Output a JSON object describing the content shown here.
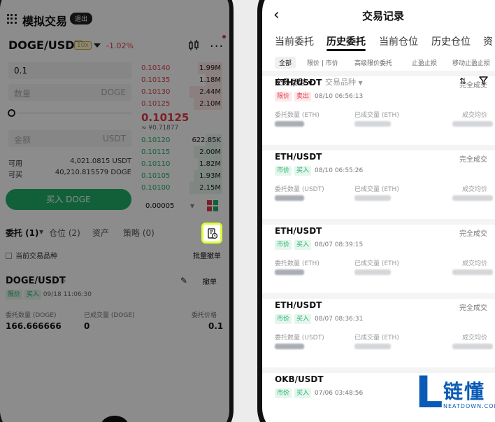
{
  "left": {
    "app_title": "模拟交易",
    "exit_label": "退出",
    "pair": "DOGE/USDT",
    "leverage": "10x",
    "change": "-1.02%",
    "price_value": "0.1",
    "qty_placeholder": "数量",
    "qty_unit": "DOGE",
    "amount_placeholder": "金额",
    "amount_unit": "USDT",
    "available_label": "可用",
    "available_value": "4,021.0815 USDT",
    "can_buy_label": "可买",
    "can_buy_value": "40,210.815579 DOGE",
    "buy_button": "买入 DOGE",
    "asks": [
      {
        "price": "0.10140",
        "qty": "1.99M",
        "depth": 0.3
      },
      {
        "price": "0.10135",
        "qty": "1.18M",
        "depth": 0.2
      },
      {
        "price": "0.10130",
        "qty": "2.44M",
        "depth": 0.4
      },
      {
        "price": "0.10125",
        "qty": "2.10M",
        "depth": 0.35
      }
    ],
    "mid_price": "0.10125",
    "mid_fiat": "≈ ¥0.71877",
    "bids": [
      {
        "price": "0.10120",
        "qty": "622.85K",
        "depth": 0.2
      },
      {
        "price": "0.10115",
        "qty": "2.00M",
        "depth": 0.35
      },
      {
        "price": "0.10110",
        "qty": "1.82M",
        "depth": 0.3
      },
      {
        "price": "0.10105",
        "qty": "1.93M",
        "depth": 0.35
      },
      {
        "price": "0.10100",
        "qty": "2.15M",
        "depth": 0.4
      }
    ],
    "depth_step": "0.00005",
    "tabs": [
      "委托 (1)",
      "仓位 (2)",
      "资产",
      "策略 (0)"
    ],
    "current_only": "当前交易品种",
    "batch_cancel": "批量撤单",
    "order": {
      "pair": "DOGE/USDT",
      "cancel": "撤单",
      "type_tag": "限价",
      "side_tag": "买入",
      "time": "09/18 11:06:30",
      "qty_label": "委托数量 (DOGE)",
      "qty_value": "166.666666",
      "filled_label": "已成交量 (DOGE)",
      "filled_value": "0",
      "price_label": "委托价格",
      "price_value": "0.1"
    }
  },
  "right": {
    "title": "交易记录",
    "tabs": [
      "当前委托",
      "历史委托",
      "当前仓位",
      "历史仓位",
      "资"
    ],
    "sub_tabs": [
      "全部",
      "限价 | 市价",
      "高级限价委托",
      "止盈止损",
      "移动止盈止损"
    ],
    "filters": [
      "交易类型",
      "交易品种"
    ],
    "records": [
      {
        "pair": "ETH/USDT",
        "status": "完全成交",
        "type_tag": "限价",
        "side_tag": "卖出",
        "time": "08/10 06:56:13",
        "col1": "委托数量 (ETH)",
        "col2": "已成交量 (ETH)",
        "col3": "成交均价"
      },
      {
        "pair": "ETH/USDT",
        "status": "完全成交",
        "type_tag": "市价",
        "side_tag": "买入",
        "time": "08/10 06:55:26",
        "col1": "委托数量 (USDT)",
        "col2": "已成交量 (ETH)",
        "col3": "成交均价"
      },
      {
        "pair": "ETH/USDT",
        "status": "完全成交",
        "type_tag": "市价",
        "side_tag": "买入",
        "time": "08/07 08:39:15",
        "col1": "委托数量 (ETH)",
        "col2": "已成交量 (ETH)",
        "col3": "成交均价"
      },
      {
        "pair": "ETH/USDT",
        "status": "完全成交",
        "type_tag": "市价",
        "side_tag": "买入",
        "time": "08/07 08:36:31",
        "col1": "委托数量 (USDT)",
        "col2": "已成交量 (ETH)",
        "col3": "成交均价"
      },
      {
        "pair": "OKB/USDT",
        "status": "",
        "type_tag": "市价",
        "side_tag": "买入",
        "time": "07/06 03:48:56",
        "col1": "",
        "col2": "",
        "col3": ""
      }
    ]
  },
  "watermark": {
    "cn": "链懂",
    "en": "NEATDOWN.COM"
  }
}
